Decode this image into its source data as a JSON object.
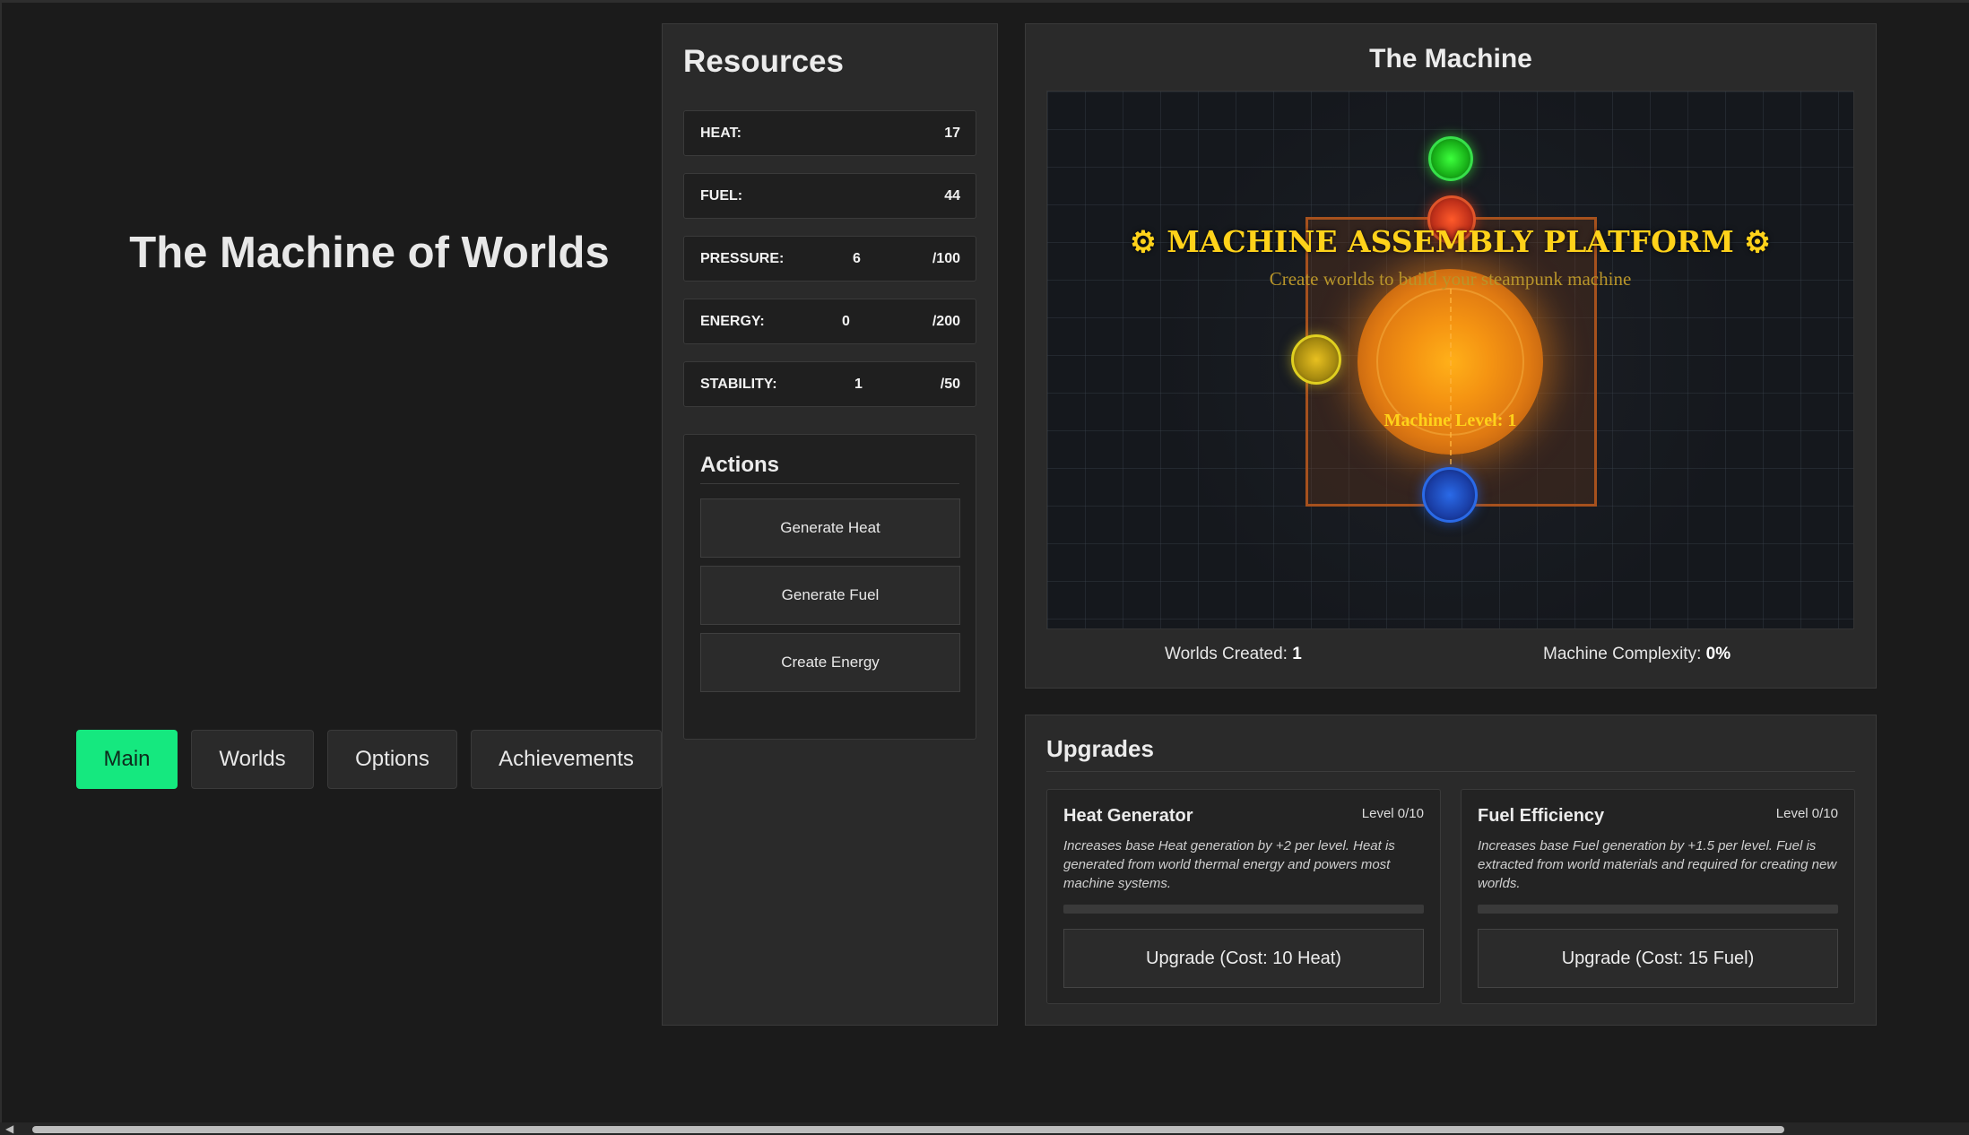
{
  "app": {
    "title": "The Machine of Worlds"
  },
  "nav": {
    "tabs": [
      {
        "label": "Main",
        "active": true
      },
      {
        "label": "Worlds",
        "active": false
      },
      {
        "label": "Options",
        "active": false
      },
      {
        "label": "Achievements",
        "active": false
      }
    ]
  },
  "resources": {
    "title": "Resources",
    "items": [
      {
        "label": "HEAT:",
        "value": "17",
        "max": ""
      },
      {
        "label": "FUEL:",
        "value": "44",
        "max": ""
      },
      {
        "label": "PRESSURE:",
        "value": "6",
        "max": "/100"
      },
      {
        "label": "ENERGY:",
        "value": "0",
        "max": "/200"
      },
      {
        "label": "STABILITY:",
        "value": "1",
        "max": "/50"
      }
    ]
  },
  "actions": {
    "title": "Actions",
    "buttons": [
      "Generate Heat",
      "Generate Fuel",
      "Create Energy"
    ]
  },
  "machine": {
    "title": "The Machine",
    "platform_title": "⚙ MACHINE ASSEMBLY PLATFORM ⚙",
    "platform_subtitle": "Create worlds to build your steampunk machine",
    "machine_level": "Machine Level: 1",
    "worlds_created_label": "Worlds Created:",
    "worlds_created_value": "1",
    "complexity_label": "Machine Complexity:",
    "complexity_value": "0%"
  },
  "upgrades": {
    "title": "Upgrades",
    "cards": [
      {
        "name": "Heat Generator",
        "level": "Level 0/10",
        "description": "Increases base Heat generation by +2 per level. Heat is generated from world thermal energy and powers most machine systems.",
        "progress": 0,
        "button": "Upgrade (Cost: 10 Heat)"
      },
      {
        "name": "Fuel Efficiency",
        "level": "Level 0/10",
        "description": "Increases base Fuel generation by +1.5 per level. Fuel is extracted from world materials and required for creating new worlds.",
        "progress": 0,
        "button": "Upgrade (Cost: 15 Fuel)"
      }
    ]
  },
  "colors": {
    "accent": "#15e87f",
    "background": "#1b1b1b",
    "panel": "#2a2a2a",
    "platform_gold": "#ffd21a"
  },
  "icons": [
    "gear-icon",
    "scroll-left-arrow-icon"
  ]
}
